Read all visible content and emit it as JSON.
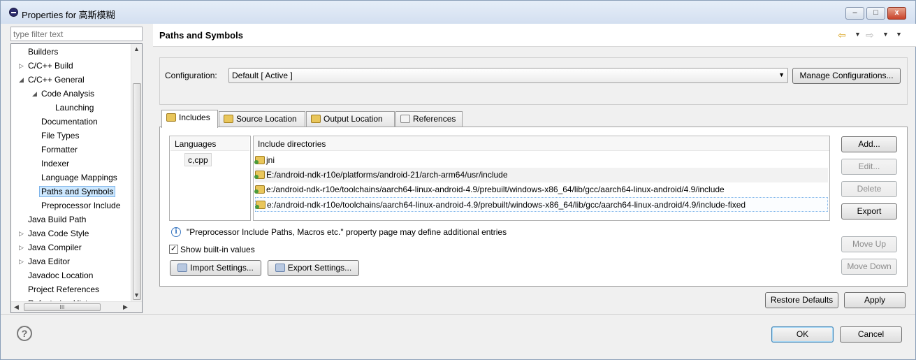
{
  "window": {
    "title": "Properties for 高斯模糊",
    "controls": {
      "minimize": "–",
      "maximize": "□",
      "close": "x"
    }
  },
  "filter": {
    "placeholder": "type filter text"
  },
  "tree": {
    "items": [
      {
        "label": "Builders",
        "level": 0,
        "expander": ""
      },
      {
        "label": "C/C++ Build",
        "level": 0,
        "expander": "▷"
      },
      {
        "label": "C/C++ General",
        "level": 0,
        "expander": "◢"
      },
      {
        "label": "Code Analysis",
        "level": 1,
        "expander": "◢"
      },
      {
        "label": "Launching",
        "level": 2,
        "expander": ""
      },
      {
        "label": "Documentation",
        "level": 1,
        "expander": ""
      },
      {
        "label": "File Types",
        "level": 1,
        "expander": ""
      },
      {
        "label": "Formatter",
        "level": 1,
        "expander": ""
      },
      {
        "label": "Indexer",
        "level": 1,
        "expander": ""
      },
      {
        "label": "Language Mappings",
        "level": 1,
        "expander": ""
      },
      {
        "label": "Paths and Symbols",
        "level": 1,
        "expander": "",
        "selected": true
      },
      {
        "label": "Preprocessor Include",
        "level": 1,
        "expander": ""
      },
      {
        "label": "Java Build Path",
        "level": 0,
        "expander": ""
      },
      {
        "label": "Java Code Style",
        "level": 0,
        "expander": "▷"
      },
      {
        "label": "Java Compiler",
        "level": 0,
        "expander": "▷"
      },
      {
        "label": "Java Editor",
        "level": 0,
        "expander": "▷"
      },
      {
        "label": "Javadoc Location",
        "level": 0,
        "expander": ""
      },
      {
        "label": "Project References",
        "level": 0,
        "expander": ""
      },
      {
        "label": "Refactoring History",
        "level": 0,
        "expander": ""
      }
    ],
    "scroll_up": "▲",
    "scroll_down": "▼",
    "scroll_left": "◀",
    "scroll_right": "▶",
    "hthumb": "III"
  },
  "page": {
    "title": "Paths and Symbols",
    "back_arrow": "⇦",
    "forward_arrow": "⇨",
    "caret": "▼"
  },
  "configuration": {
    "label": "Configuration:",
    "value": "Default  [ Active ]",
    "arrow": "▼",
    "manage_button": "Manage Configurations..."
  },
  "tabs": [
    {
      "label": "Includes",
      "active": true
    },
    {
      "label": "Source Location",
      "active": false
    },
    {
      "label": "Output Location",
      "active": false
    },
    {
      "label": "References",
      "active": false
    }
  ],
  "includes": {
    "languages_header": "Languages",
    "languages": [
      "c,cpp"
    ],
    "dirs_header": "Include directories",
    "directories": [
      "jni",
      "E:/android-ndk-r10e/platforms/android-21/arch-arm64/usr/include",
      "e:/android-ndk-r10e/toolchains/aarch64-linux-android-4.9/prebuilt/windows-x86_64/lib/gcc/aarch64-linux-android/4.9/include",
      "e:/android-ndk-r10e/toolchains/aarch64-linux-android-4.9/prebuilt/windows-x86_64/lib/gcc/aarch64-linux-android/4.9/include-fixed"
    ],
    "buttons": {
      "add": "Add...",
      "edit": "Edit...",
      "delete": "Delete",
      "export": "Export",
      "move_up": "Move Up",
      "move_down": "Move Down"
    },
    "info_symbol": "i",
    "info_text": "\"Preprocessor Include Paths, Macros etc.\" property page may define additional entries",
    "show_builtin": {
      "label": "Show built-in values",
      "checked": true,
      "mark": "✓"
    },
    "import_button": "Import Settings...",
    "export_settings_button": "Export Settings..."
  },
  "footer": {
    "restore_defaults": "Restore Defaults",
    "apply": "Apply",
    "help_symbol": "?",
    "ok": "OK",
    "cancel": "Cancel"
  }
}
